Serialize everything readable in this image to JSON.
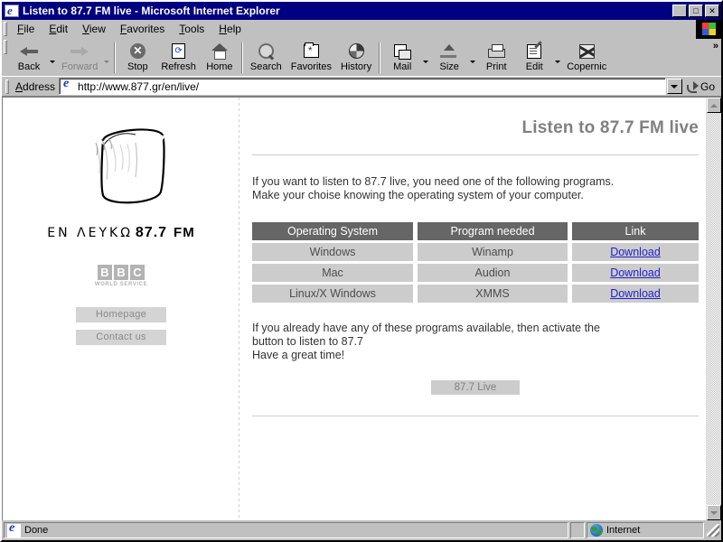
{
  "window": {
    "title": "Listen to 87.7 FM live - Microsoft Internet Explorer",
    "icon": "ie-document-icon",
    "minimize": "_",
    "maximize": "□",
    "close": "✕"
  },
  "menu": {
    "items": [
      {
        "label": "File",
        "accel": "F",
        "rest": "ile"
      },
      {
        "label": "Edit",
        "accel": "E",
        "rest": "dit"
      },
      {
        "label": "View",
        "accel": "V",
        "rest": "iew"
      },
      {
        "label": "Favorites",
        "accel": "F",
        "rest": "avorites"
      },
      {
        "label": "Tools",
        "accel": "T",
        "rest": "ools"
      },
      {
        "label": "Help",
        "accel": "H",
        "rest": "elp"
      }
    ],
    "brand_icon": "windows-flag-icon"
  },
  "toolbar": {
    "overflow": "»",
    "buttons": [
      {
        "label": "Back",
        "icon": "back-arrow-icon",
        "dropdown": true,
        "disabled": false
      },
      {
        "label": "Forward",
        "icon": "forward-arrow-icon",
        "dropdown": true,
        "disabled": true
      },
      {
        "label": "Stop",
        "icon": "stop-icon",
        "dropdown": false,
        "disabled": false
      },
      {
        "label": "Refresh",
        "icon": "refresh-icon",
        "dropdown": false,
        "disabled": false
      },
      {
        "label": "Home",
        "icon": "home-icon",
        "dropdown": false,
        "disabled": false
      },
      {
        "label": "Search",
        "icon": "search-icon",
        "dropdown": false,
        "disabled": false
      },
      {
        "label": "Favorites",
        "icon": "favorites-folder-icon",
        "dropdown": false,
        "disabled": false
      },
      {
        "label": "History",
        "icon": "history-clock-icon",
        "dropdown": false,
        "disabled": false
      },
      {
        "label": "Mail",
        "icon": "mail-icon",
        "dropdown": true,
        "disabled": false
      },
      {
        "label": "Size",
        "icon": "font-size-icon",
        "dropdown": true,
        "disabled": false
      },
      {
        "label": "Print",
        "icon": "printer-icon",
        "dropdown": false,
        "disabled": false
      },
      {
        "label": "Edit",
        "icon": "edit-pencil-icon",
        "dropdown": true,
        "disabled": false
      },
      {
        "label": "Copernic",
        "icon": "copernic-icon",
        "dropdown": false,
        "disabled": false
      }
    ]
  },
  "address": {
    "label": "Address",
    "label_accel": "A",
    "label_rest": "ddress",
    "url": "http://www.877.gr/en/live/",
    "placeholder": "",
    "icon": "ie-document-icon",
    "go_label": "Go",
    "go_icon": "go-arrow-icon",
    "dropdown_icon": "chevron-down-icon"
  },
  "sidebar": {
    "logo_mark": "en-lefko-drum-sketch-logo",
    "logo_greek": "ΕΝ ΛΕΥΚΩ",
    "logo_number": "87.7",
    "logo_fm": "FM",
    "bbc": {
      "letters": [
        "B",
        "B",
        "C"
      ],
      "subtitle": "WORLD SERVICE"
    },
    "buttons": [
      {
        "label": "Homepage",
        "name": "homepage-button"
      },
      {
        "label": "Contact us",
        "name": "contact-us-button"
      }
    ]
  },
  "content": {
    "heading": "Listen to 87.7 FM live",
    "intro": [
      "If you want to listen to 87.7 live, you need one of the following programs.",
      "Make your choise knowing the operating system of your computer."
    ],
    "table": {
      "headers": [
        "Operating System",
        "Program needed",
        "Link"
      ],
      "rows": [
        {
          "os": "Windows",
          "program": "Winamp",
          "link": "Download"
        },
        {
          "os": "Mac",
          "program": "Audion",
          "link": "Download"
        },
        {
          "os": "Linux/X Windows",
          "program": "XMMS",
          "link": "Download"
        }
      ]
    },
    "outro": [
      "If you already have any of these programs available, then activate the",
      "button to listen to 87.7",
      "Have a great time!"
    ],
    "live_button": "87.7 Live"
  },
  "scrollbar": {
    "up_icon": "scroll-up-arrow-icon",
    "down_icon": "scroll-down-arrow-icon"
  },
  "statusbar": {
    "message": "Done",
    "message_icon": "ie-document-icon",
    "zone": "Internet",
    "zone_icon": "globe-icon",
    "resize_grip": "resize-grip"
  },
  "colors": {
    "titlebar": "#000080",
    "chrome": "#c0c0c0",
    "heading": "#808080",
    "table_header_bg": "#666666",
    "table_cell_bg": "#cccccc",
    "link": "#2222cc"
  }
}
